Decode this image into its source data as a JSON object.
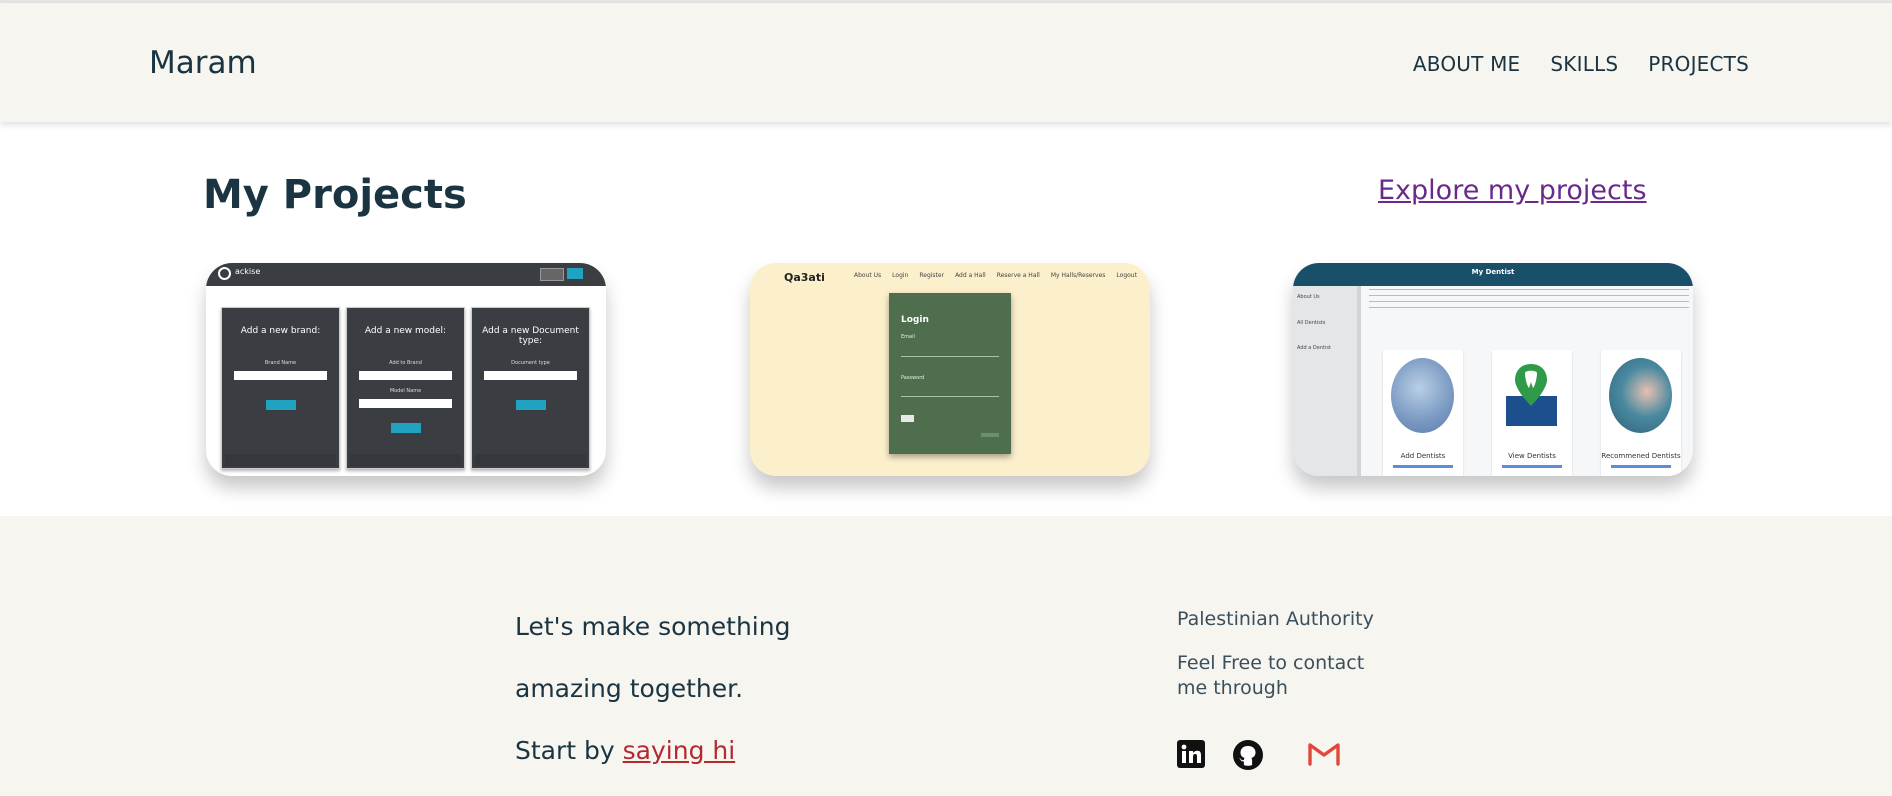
{
  "header": {
    "brand": "Maram",
    "nav": [
      "ABOUT ME",
      "SKILLS",
      "PROJECTS"
    ]
  },
  "projects": {
    "title": "My Projects",
    "explore_link": "Explore my projects",
    "cards": [
      {
        "logo": "ackise",
        "panels": [
          {
            "title": "Add a new brand:",
            "fields": [
              "Brand Name"
            ]
          },
          {
            "title": "Add a new model:",
            "fields": [
              "Add to Brand",
              "Model Name"
            ]
          },
          {
            "title": "Add a new Document type:",
            "fields": [
              "Document type"
            ]
          }
        ]
      },
      {
        "logo": "Qa3ati",
        "nav": [
          "About Us",
          "Login",
          "Register",
          "Add a Hall",
          "Reserve a Hall",
          "My Halls/Reserves",
          "Logout"
        ],
        "login_title": "Login",
        "email_label": "Email",
        "password_label": "Password"
      },
      {
        "title": "My Dentist",
        "sidebar": [
          "About Us",
          "All Dentists",
          "Add a Dentist"
        ],
        "tiles": [
          "Add Dentists",
          "View Dentists",
          "Recommened Dentists"
        ]
      }
    ]
  },
  "footer": {
    "line1": "Let's make something",
    "line2": "amazing together.",
    "line3_prefix": "Start by ",
    "line3_link": "saying hi",
    "location": "Palestinian Authority",
    "contact_line1": "Feel Free to contact",
    "contact_line2": "me through",
    "social_icons": [
      "linkedin-icon",
      "github-icon",
      "gmail-icon"
    ]
  },
  "colors": {
    "accent_red": "#b22a2f",
    "link_purple": "#6a2a8a",
    "text_dark": "#1b3442",
    "gmail_red": "#e0493a"
  }
}
